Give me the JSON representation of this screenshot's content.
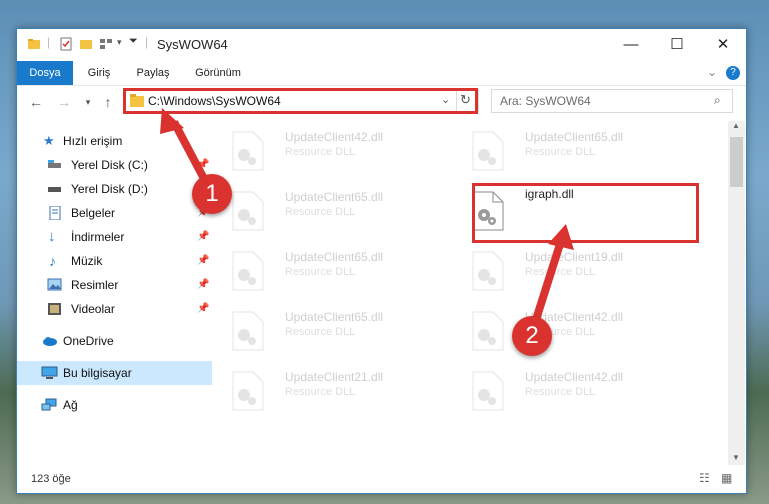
{
  "window": {
    "title": "SysWOW64"
  },
  "ribbon": {
    "tabs": [
      "Dosya",
      "Giriş",
      "Paylaş",
      "Görünüm"
    ]
  },
  "address": {
    "path": "C:\\Windows\\SysWOW64"
  },
  "search": {
    "placeholder": "Ara: SysWOW64"
  },
  "sidebar": {
    "items": [
      {
        "label": "Hızlı erişim",
        "icon": "star-icon"
      },
      {
        "label": "Yerel Disk (C:)",
        "icon": "drive-icon"
      },
      {
        "label": "Yerel Disk (D:)",
        "icon": "drive-icon"
      },
      {
        "label": "Belgeler",
        "icon": "documents-icon"
      },
      {
        "label": "İndirmeler",
        "icon": "download-icon"
      },
      {
        "label": "Müzik",
        "icon": "music-icon"
      },
      {
        "label": "Resimler",
        "icon": "pictures-icon"
      },
      {
        "label": "Videolar",
        "icon": "videos-icon"
      },
      {
        "label": "OneDrive",
        "icon": "cloud-icon"
      },
      {
        "label": "Bu bilgisayar",
        "icon": "computer-icon"
      },
      {
        "label": "Ağ",
        "icon": "network-icon"
      }
    ]
  },
  "files": [
    {
      "name": "UpdateClient42.dll",
      "type": "Resource DLL"
    },
    {
      "name": "UpdateClient65.dll",
      "type": "Resource DLL"
    },
    {
      "name": "UpdateClient65.dll",
      "type": "Resource DLL"
    },
    {
      "name": "igraph.dll",
      "type": ""
    },
    {
      "name": "UpdateClient65.dll",
      "type": "Resource DLL"
    },
    {
      "name": "UpdateClient19.dll",
      "type": "Resource DLL"
    },
    {
      "name": "UpdateClient65.dll",
      "type": "Resource DLL"
    },
    {
      "name": "UpdateClient42.dll",
      "type": "Resource DLL"
    },
    {
      "name": "UpdateClient21.dll",
      "type": "Resource DLL"
    },
    {
      "name": "UpdateClient42.dll",
      "type": "Resource DLL"
    }
  ],
  "status": {
    "count": "123 öğe"
  },
  "annotations": {
    "step1": "1",
    "step2": "2",
    "color": "#d9322f"
  }
}
